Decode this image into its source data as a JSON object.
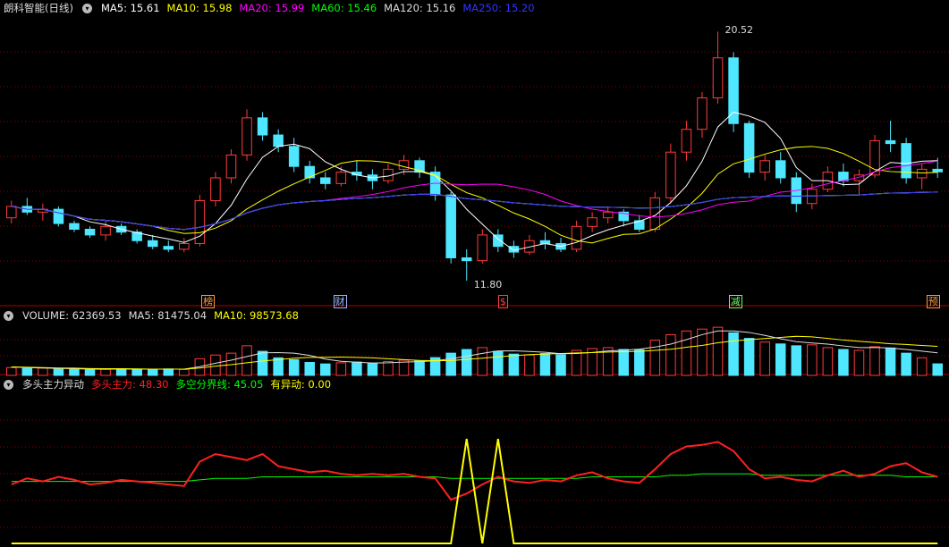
{
  "title": "朗科智能(日线)",
  "price_panel": {
    "ma_legend": [
      {
        "label": "MA5: 15.61",
        "color": "#ffffff"
      },
      {
        "label": "MA10: 15.98",
        "color": "#ffff00"
      },
      {
        "label": "MA20: 15.99",
        "color": "#ff00ff"
      },
      {
        "label": "MA60: 15.46",
        "color": "#00ff00"
      },
      {
        "label": "MA120: 15.16",
        "color": "#dddddd"
      },
      {
        "label": "MA250: 15.20",
        "color": "#3333ff"
      }
    ],
    "high_label": "20.52",
    "low_label": "11.80",
    "event_tags": [
      {
        "text": "榜",
        "color": "#ff9a3c",
        "i": 6
      },
      {
        "text": "财",
        "color": "#9ab8ff",
        "i": 10
      },
      {
        "text": "$",
        "color": "#ff4040",
        "i": 15
      },
      {
        "text": "减",
        "color": "#66ff66",
        "i": 22
      },
      {
        "text": "预",
        "color": "#ff9a3c",
        "i": 28
      }
    ]
  },
  "volume_panel": {
    "legend": [
      {
        "label": "VOLUME: 62369.53",
        "color": "#dddddd"
      },
      {
        "label": "MA5: 81475.04",
        "color": "#dddddd"
      },
      {
        "label": "MA10: 98573.68",
        "color": "#ffff00"
      }
    ]
  },
  "indicator_panel": {
    "legend": [
      {
        "label": "多头主力异动",
        "color": "#dddddd"
      },
      {
        "label": "多头主力: 48.30",
        "color": "#ff2020"
      },
      {
        "label": "多空分界线: 45.05",
        "color": "#00ff00"
      },
      {
        "label": "有异动: 0.00",
        "color": "#ffff00"
      }
    ]
  },
  "colors": {
    "up": "#ff3b3b",
    "down": "#4fe6ff",
    "grid": "#8b0000"
  },
  "chart_data": {
    "type": "candlestick",
    "description_units": "price in CNY, volume in lots",
    "candles": [
      {
        "o": 14.0,
        "h": 14.6,
        "l": 13.8,
        "c": 14.4
      },
      {
        "o": 14.4,
        "h": 14.7,
        "l": 14.1,
        "c": 14.2
      },
      {
        "o": 14.2,
        "h": 14.5,
        "l": 13.9,
        "c": 14.3
      },
      {
        "o": 14.3,
        "h": 14.4,
        "l": 13.7,
        "c": 13.8
      },
      {
        "o": 13.8,
        "h": 13.9,
        "l": 13.5,
        "c": 13.6
      },
      {
        "o": 13.6,
        "h": 13.7,
        "l": 13.3,
        "c": 13.4
      },
      {
        "o": 13.4,
        "h": 13.9,
        "l": 13.2,
        "c": 13.7
      },
      {
        "o": 13.7,
        "h": 13.8,
        "l": 13.4,
        "c": 13.5
      },
      {
        "o": 13.5,
        "h": 13.6,
        "l": 13.1,
        "c": 13.2
      },
      {
        "o": 13.2,
        "h": 13.4,
        "l": 12.9,
        "c": 13.0
      },
      {
        "o": 13.0,
        "h": 13.2,
        "l": 12.8,
        "c": 12.9
      },
      {
        "o": 12.9,
        "h": 13.3,
        "l": 12.8,
        "c": 13.1
      },
      {
        "o": 13.1,
        "h": 14.8,
        "l": 13.0,
        "c": 14.6
      },
      {
        "o": 14.6,
        "h": 15.6,
        "l": 14.4,
        "c": 15.4
      },
      {
        "o": 15.4,
        "h": 16.4,
        "l": 15.2,
        "c": 16.2
      },
      {
        "o": 16.2,
        "h": 17.8,
        "l": 16.0,
        "c": 17.5
      },
      {
        "o": 17.5,
        "h": 17.7,
        "l": 16.7,
        "c": 16.9
      },
      {
        "o": 16.9,
        "h": 17.1,
        "l": 16.3,
        "c": 16.5
      },
      {
        "o": 16.5,
        "h": 16.8,
        "l": 15.6,
        "c": 15.8
      },
      {
        "o": 15.8,
        "h": 16.0,
        "l": 15.2,
        "c": 15.4
      },
      {
        "o": 15.4,
        "h": 15.6,
        "l": 15.0,
        "c": 15.2
      },
      {
        "o": 15.2,
        "h": 15.8,
        "l": 15.1,
        "c": 15.6
      },
      {
        "o": 15.6,
        "h": 16.0,
        "l": 15.3,
        "c": 15.5
      },
      {
        "o": 15.5,
        "h": 15.7,
        "l": 15.0,
        "c": 15.3
      },
      {
        "o": 15.3,
        "h": 15.9,
        "l": 15.2,
        "c": 15.7
      },
      {
        "o": 15.7,
        "h": 16.2,
        "l": 15.5,
        "c": 16.0
      },
      {
        "o": 16.0,
        "h": 16.1,
        "l": 15.4,
        "c": 15.6
      },
      {
        "o": 15.6,
        "h": 15.8,
        "l": 14.6,
        "c": 14.8
      },
      {
        "o": 14.8,
        "h": 14.9,
        "l": 12.4,
        "c": 12.6
      },
      {
        "o": 12.6,
        "h": 12.9,
        "l": 11.8,
        "c": 12.5
      },
      {
        "o": 12.5,
        "h": 13.6,
        "l": 12.4,
        "c": 13.4
      },
      {
        "o": 13.4,
        "h": 13.6,
        "l": 12.8,
        "c": 13.0
      },
      {
        "o": 13.0,
        "h": 13.2,
        "l": 12.6,
        "c": 12.8
      },
      {
        "o": 12.8,
        "h": 13.4,
        "l": 12.7,
        "c": 13.2
      },
      {
        "o": 13.2,
        "h": 13.5,
        "l": 12.9,
        "c": 13.1
      },
      {
        "o": 13.1,
        "h": 13.3,
        "l": 12.8,
        "c": 12.9
      },
      {
        "o": 12.9,
        "h": 13.9,
        "l": 12.8,
        "c": 13.7
      },
      {
        "o": 13.7,
        "h": 14.2,
        "l": 13.5,
        "c": 14.0
      },
      {
        "o": 14.0,
        "h": 14.4,
        "l": 13.8,
        "c": 14.2
      },
      {
        "o": 14.2,
        "h": 14.3,
        "l": 13.7,
        "c": 13.9
      },
      {
        "o": 13.9,
        "h": 14.1,
        "l": 13.5,
        "c": 13.6
      },
      {
        "o": 13.6,
        "h": 14.9,
        "l": 13.5,
        "c": 14.7
      },
      {
        "o": 14.7,
        "h": 16.6,
        "l": 14.5,
        "c": 16.3
      },
      {
        "o": 16.3,
        "h": 17.4,
        "l": 16.0,
        "c": 17.1
      },
      {
        "o": 17.1,
        "h": 18.4,
        "l": 16.8,
        "c": 18.2
      },
      {
        "o": 18.2,
        "h": 20.52,
        "l": 18.0,
        "c": 19.6
      },
      {
        "o": 19.6,
        "h": 19.8,
        "l": 17.0,
        "c": 17.3
      },
      {
        "o": 17.3,
        "h": 17.4,
        "l": 15.4,
        "c": 15.6
      },
      {
        "o": 15.6,
        "h": 16.2,
        "l": 15.3,
        "c": 16.0
      },
      {
        "o": 16.0,
        "h": 16.3,
        "l": 15.2,
        "c": 15.4
      },
      {
        "o": 15.4,
        "h": 15.6,
        "l": 14.2,
        "c": 14.5
      },
      {
        "o": 14.5,
        "h": 15.2,
        "l": 14.3,
        "c": 15.0
      },
      {
        "o": 15.0,
        "h": 15.8,
        "l": 14.9,
        "c": 15.6
      },
      {
        "o": 15.6,
        "h": 15.9,
        "l": 15.1,
        "c": 15.3
      },
      {
        "o": 15.3,
        "h": 15.7,
        "l": 14.8,
        "c": 15.5
      },
      {
        "o": 15.5,
        "h": 16.9,
        "l": 15.4,
        "c": 16.7
      },
      {
        "o": 16.7,
        "h": 17.4,
        "l": 16.3,
        "c": 16.6
      },
      {
        "o": 16.6,
        "h": 16.8,
        "l": 15.2,
        "c": 15.4
      },
      {
        "o": 15.4,
        "h": 15.9,
        "l": 15.0,
        "c": 15.7
      },
      {
        "o": 15.7,
        "h": 16.1,
        "l": 15.4,
        "c": 15.61
      }
    ],
    "volume": [
      42,
      38,
      40,
      36,
      34,
      30,
      33,
      35,
      34,
      33,
      35,
      32,
      90,
      110,
      120,
      160,
      130,
      95,
      85,
      70,
      62,
      68,
      72,
      64,
      75,
      82,
      78,
      96,
      120,
      140,
      150,
      130,
      115,
      110,
      118,
      112,
      135,
      145,
      150,
      140,
      138,
      190,
      220,
      240,
      250,
      260,
      230,
      200,
      180,
      170,
      160,
      165,
      150,
      140,
      135,
      155,
      148,
      120,
      95,
      62.37
    ],
    "volume_ma5": [
      45,
      42,
      40,
      38,
      36,
      34,
      33,
      34,
      34,
      34,
      34,
      34,
      47,
      66,
      82,
      102,
      122,
      123,
      120,
      108,
      88,
      76,
      71,
      67,
      68,
      72,
      74,
      79,
      90,
      104,
      119,
      132,
      133,
      129,
      125,
      117,
      118,
      124,
      132,
      136,
      142,
      153,
      169,
      193,
      220,
      240,
      240,
      232,
      216,
      198,
      182,
      175,
      169,
      159,
      150,
      151,
      148,
      140,
      131,
      122
    ],
    "volume_ma10": [
      46,
      44,
      42,
      40,
      39,
      37,
      36,
      36,
      35,
      34,
      34,
      34,
      40,
      50,
      58,
      68,
      78,
      85,
      93,
      97,
      98,
      99,
      97,
      95,
      90,
      85,
      81,
      79,
      80,
      86,
      93,
      100,
      107,
      112,
      115,
      118,
      121,
      123,
      126,
      128,
      130,
      135,
      141,
      152,
      162,
      176,
      186,
      193,
      199,
      205,
      211,
      208,
      200,
      191,
      184,
      178,
      171,
      167,
      162,
      157
    ],
    "indicator": {
      "main_force": [
        40,
        44,
        42,
        45,
        43,
        40,
        41,
        43,
        42,
        41,
        40,
        39,
        55,
        60,
        58,
        56,
        60,
        52,
        50,
        48,
        49,
        47,
        46,
        47,
        46,
        47,
        45,
        44,
        30,
        34,
        40,
        45,
        42,
        41,
        43,
        42,
        46,
        48,
        44,
        42,
        41,
        50,
        60,
        65,
        66,
        68,
        62,
        50,
        44,
        45,
        43,
        42,
        46,
        49,
        45,
        47,
        52,
        54,
        48,
        45
      ],
      "divider": [
        42,
        42,
        42,
        42,
        42,
        42,
        42,
        42,
        42,
        42,
        42,
        42,
        43,
        44,
        44,
        44,
        45,
        45,
        45,
        45,
        45,
        45,
        45,
        45,
        45,
        45,
        45,
        45,
        44,
        44,
        44,
        44,
        44,
        44,
        44,
        44,
        44,
        45,
        45,
        45,
        45,
        45,
        46,
        46,
        47,
        47,
        47,
        47,
        46,
        46,
        46,
        46,
        46,
        46,
        46,
        46,
        46,
        45,
        45,
        45.05
      ],
      "alert": [
        0,
        0,
        0,
        0,
        0,
        0,
        0,
        0,
        0,
        0,
        0,
        0,
        0,
        0,
        0,
        0,
        0,
        0,
        0,
        0,
        0,
        0,
        0,
        0,
        0,
        0,
        0,
        0,
        0,
        100,
        0,
        100,
        0,
        0,
        0,
        0,
        0,
        0,
        0,
        0,
        0,
        0,
        0,
        0,
        0,
        0,
        0,
        0,
        0,
        0,
        0,
        0,
        0,
        0,
        0,
        0,
        0,
        0,
        0,
        0
      ]
    }
  }
}
